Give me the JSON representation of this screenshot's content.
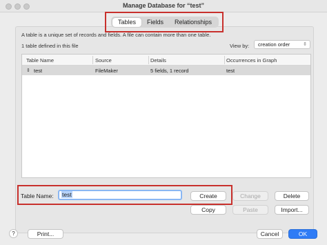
{
  "window": {
    "title": "Manage Database for “test”"
  },
  "tabs": [
    {
      "label": "Tables",
      "active": true
    },
    {
      "label": "Fields",
      "active": false
    },
    {
      "label": "Relationships",
      "active": false
    }
  ],
  "description": "A table is a unique set of records and fields. A file can contain more than one table.",
  "table_count": "1 table defined in this file",
  "view_by": {
    "label": "View by:",
    "value": "creation order"
  },
  "table": {
    "columns": [
      "Table Name",
      "Source",
      "Details",
      "Occurrences in Graph"
    ],
    "rows": [
      {
        "name": "test",
        "source": "FileMaker",
        "details": "5 fields, 1 record",
        "occurrences": "test"
      }
    ]
  },
  "table_name_field": {
    "label": "Table Name:",
    "value": "test"
  },
  "buttons": {
    "create": "Create",
    "change": "Change",
    "delete": "Delete",
    "copy": "Copy",
    "paste": "Paste",
    "import": "Import...",
    "print": "Print...",
    "cancel": "Cancel",
    "ok": "OK",
    "help": "?"
  },
  "colors": {
    "highlight": "#c8302c",
    "accent": "#2f7cf6"
  }
}
